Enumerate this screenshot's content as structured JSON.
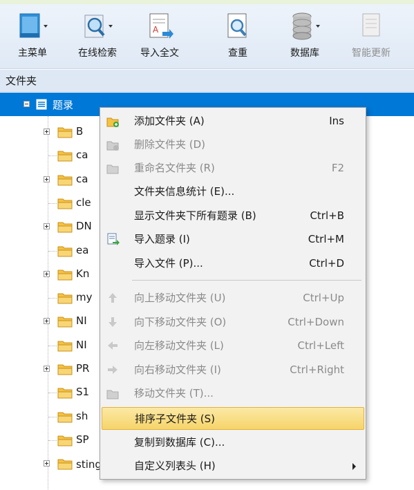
{
  "toolbar": {
    "buttons": [
      {
        "label": "主菜单",
        "icon": "main-menu-icon"
      },
      {
        "label": "在线检索",
        "icon": "online-search-icon"
      },
      {
        "label": "导入全文",
        "icon": "import-fulltext-icon"
      },
      {
        "label": "查重",
        "icon": "duplicate-check-icon"
      },
      {
        "label": "数据库",
        "icon": "database-icon"
      },
      {
        "label": "智能更新",
        "icon": "smart-update-icon",
        "disabled": true
      }
    ]
  },
  "folder_panel": {
    "header": "文件夹",
    "root_label": "题录",
    "nodes": [
      {
        "label": "B",
        "expandable": true
      },
      {
        "label": "ca",
        "expandable": false
      },
      {
        "label": "ca",
        "expandable": true
      },
      {
        "label": "cle",
        "expandable": false
      },
      {
        "label": "DN",
        "expandable": true
      },
      {
        "label": "ea",
        "expandable": false
      },
      {
        "label": "Kn",
        "expandable": true
      },
      {
        "label": "my",
        "expandable": false
      },
      {
        "label": "NI",
        "expandable": true
      },
      {
        "label": "NI",
        "expandable": false
      },
      {
        "label": "PR",
        "expandable": true
      },
      {
        "label": "S1",
        "expandable": false
      },
      {
        "label": "sh",
        "expandable": false
      },
      {
        "label": "SP",
        "expandable": false
      },
      {
        "label": "sting 超声与cancer",
        "expandable": true
      }
    ]
  },
  "context_menu": {
    "items": [
      {
        "label": "添加文件夹 (A)",
        "shortcut": "Ins",
        "icon": "add-folder-icon",
        "enabled": true
      },
      {
        "label": "删除文件夹 (D)",
        "shortcut": "",
        "icon": "delete-folder-icon",
        "enabled": false
      },
      {
        "label": "重命名文件夹 (R)",
        "shortcut": "F2",
        "icon": "rename-folder-icon",
        "enabled": false
      },
      {
        "label": "文件夹信息统计 (E)...",
        "shortcut": "",
        "icon": "",
        "enabled": true
      },
      {
        "label": "显示文件夹下所有题录 (B)",
        "shortcut": "Ctrl+B",
        "icon": "",
        "enabled": true
      },
      {
        "label": "导入题录 (I)",
        "shortcut": "Ctrl+M",
        "icon": "import-records-icon",
        "enabled": true
      },
      {
        "label": "导入文件 (P)...",
        "shortcut": "Ctrl+D",
        "icon": "",
        "enabled": true
      },
      {
        "label": "向上移动文件夹 (U)",
        "shortcut": "Ctrl+Up",
        "icon": "arrow-up-icon",
        "enabled": false
      },
      {
        "label": "向下移动文件夹 (O)",
        "shortcut": "Ctrl+Down",
        "icon": "arrow-down-icon",
        "enabled": false
      },
      {
        "label": "向左移动文件夹 (L)",
        "shortcut": "Ctrl+Left",
        "icon": "arrow-left-icon",
        "enabled": false
      },
      {
        "label": "向右移动文件夹 (I)",
        "shortcut": "Ctrl+Right",
        "icon": "arrow-right-icon",
        "enabled": false
      },
      {
        "label": "移动文件夹 (T)...",
        "shortcut": "",
        "icon": "move-folder-icon",
        "enabled": false
      },
      {
        "label": "排序子文件夹 (S)",
        "shortcut": "",
        "icon": "",
        "enabled": true,
        "highlighted": true
      },
      {
        "label": "复制到数据库 (C)...",
        "shortcut": "",
        "icon": "",
        "enabled": true
      },
      {
        "label": "自定义列表头 (H)",
        "shortcut": "",
        "icon": "",
        "enabled": true,
        "submenu": true
      }
    ]
  },
  "colors": {
    "selection_blue": "#0078d7",
    "highlight_gold": "#f6d46a",
    "folder_yellow": "#f5c242"
  }
}
